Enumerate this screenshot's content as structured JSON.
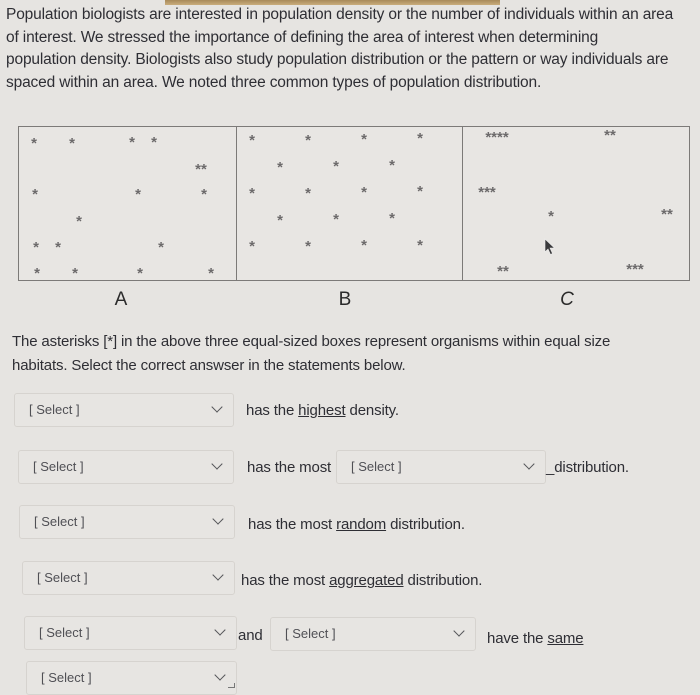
{
  "intro_paragraph": {
    "lines": [
      "Population biologists are interested in population density or the number of individuals within an area",
      "of interest.  We stressed the importance of defining the area of interest when determining",
      "population density.  Biologists also study population distribution or the pattern or way individuals are",
      "spaced within an area.  We noted three common types of population distribution."
    ]
  },
  "habitats": [
    {
      "label": "A",
      "pattern": "random",
      "asterisk_groups": [
        "*",
        "*",
        "*",
        "*",
        "**",
        "*",
        "*",
        "*",
        "*",
        "*",
        "*",
        "*",
        "*",
        "*",
        "*",
        "*",
        "*"
      ]
    },
    {
      "label": "B",
      "pattern": "uniform",
      "asterisk_groups": [
        "*",
        "*",
        "*",
        "*",
        "*",
        "*",
        "*",
        "*",
        "*",
        "*",
        "*",
        "*",
        "*",
        "*",
        "*",
        "*",
        "*",
        "*",
        "*",
        "*",
        "*",
        "*"
      ]
    },
    {
      "label": "C",
      "pattern": "clumped",
      "asterisk_groups": [
        "****",
        "**",
        "***",
        "*",
        "**",
        "**",
        "***"
      ]
    }
  ],
  "instructions": {
    "lines": [
      "The asterisks [*] in the above three equal-sized boxes represent organisms within equal size",
      "habitats.  Select the correct answser in the statements below."
    ]
  },
  "statements": {
    "s1": {
      "select": "[ Select ]",
      "text_before": "has the ",
      "emph": "highest",
      "text_after": " density."
    },
    "s2": {
      "select_a": "[ Select ]",
      "middle": "has the most",
      "select_b": "[ Select ]",
      "text_after": "_distribution."
    },
    "s3": {
      "select": "[ Select ]",
      "text_before": "has the most ",
      "emph": "random",
      "text_after": " distribution."
    },
    "s4": {
      "select": "[ Select ]",
      "text_before": "has the most ",
      "emph": "aggregated",
      "text_after": " distribution."
    },
    "s5": {
      "select_a": "[ Select ]",
      "middle": "and",
      "select_b": "[ Select ]",
      "text_before": "have the ",
      "emph": "same"
    },
    "s6": {
      "select": "[ Select ]"
    }
  },
  "icons": {
    "dropdown": "chevron-down-icon",
    "cursor": "mouse-pointer-icon"
  }
}
